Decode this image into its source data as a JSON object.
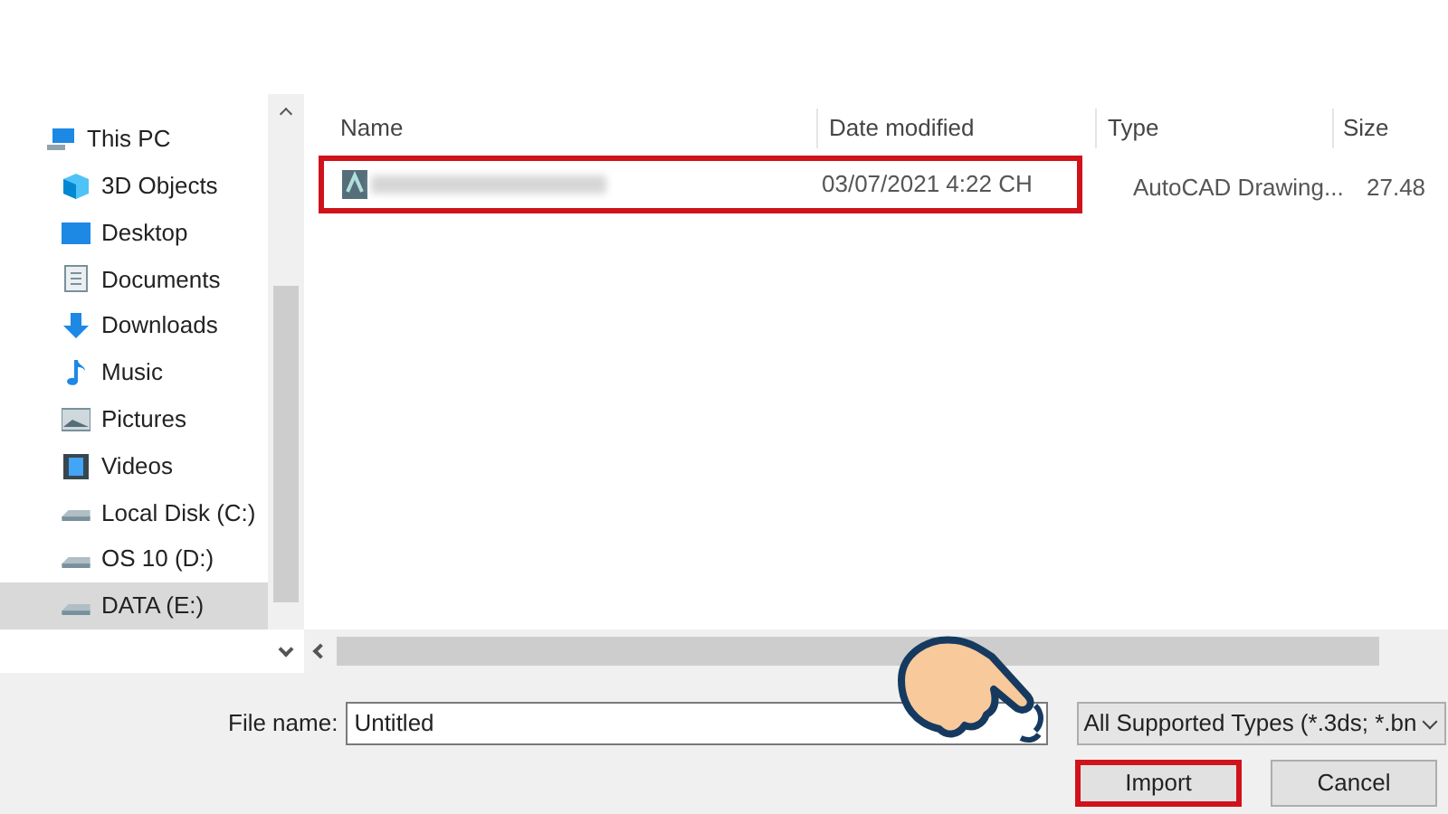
{
  "sidebar": {
    "items": [
      {
        "label": "This PC",
        "selected": false,
        "children": [
          {
            "label": "3D Objects",
            "selected": false
          },
          {
            "label": "Desktop",
            "selected": false
          },
          {
            "label": "Documents",
            "selected": false
          },
          {
            "label": "Downloads",
            "selected": false
          },
          {
            "label": "Music",
            "selected": false
          },
          {
            "label": "Pictures",
            "selected": false
          },
          {
            "label": "Videos",
            "selected": false
          },
          {
            "label": "Local Disk (C:)",
            "selected": false
          },
          {
            "label": "OS 10 (D:)",
            "selected": false
          },
          {
            "label": "DATA (E:)",
            "selected": true
          }
        ]
      }
    ]
  },
  "table": {
    "columns": [
      "Name",
      "Date modified",
      "Type",
      "Size"
    ],
    "rows": [
      {
        "date_modified": "03/07/2021 4:22 CH",
        "type": "AutoCAD Drawing...",
        "size": "27.48",
        "highlighted": true
      }
    ]
  },
  "file_name": {
    "label": "File name:",
    "value": "Untitled"
  },
  "file_type": {
    "value": "All Supported Types (*.3ds; *.bn"
  },
  "buttons": [
    {
      "label": "Import",
      "highlighted": true
    },
    {
      "label": "Cancel",
      "highlighted": false
    }
  ]
}
